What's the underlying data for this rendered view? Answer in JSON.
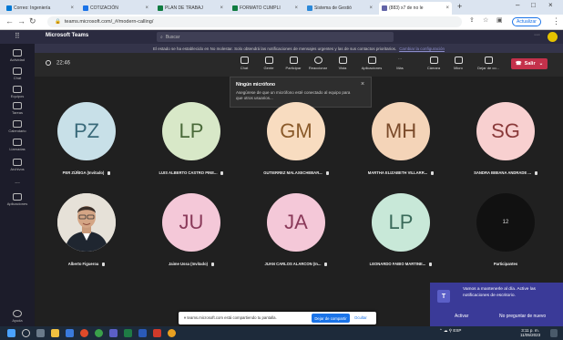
{
  "browser": {
    "tabs": [
      {
        "label": "Correo: Ingeniería",
        "color": "#0078d4"
      },
      {
        "label": "COTIZACIÓN",
        "color": "#1a73e8"
      },
      {
        "label": "PLAN DE TRABAJ",
        "color": "#107c41"
      },
      {
        "label": "FORMATO CUMPLI",
        "color": "#107c41"
      },
      {
        "label": "Sistema de Gestió",
        "color": "#2b88d8"
      },
      {
        "label": "(883) x7 de no le",
        "color": "#6264a7"
      }
    ],
    "new_tab": "+",
    "url": "teams.microsoft.com/_#/modern-calling/",
    "update_label": "Actualizar"
  },
  "teams": {
    "title": "Microsoft Teams",
    "search_placeholder": "Buscar"
  },
  "notice": {
    "text": "El estado se ha establecido en No molestar. Solo obtendrá las notificaciones de mensajes urgentes y las de sus contactos prioritarios.",
    "link": "Cambiar la configuración"
  },
  "rail": [
    {
      "label": "Actividad"
    },
    {
      "label": "Chat"
    },
    {
      "label": "Equipos"
    },
    {
      "label": "Tareas"
    },
    {
      "label": "Calendario"
    },
    {
      "label": "Llamadas"
    },
    {
      "label": "Archivos"
    },
    {
      "label": "..."
    },
    {
      "label": "Aplicaciones"
    },
    {
      "label": "Ayuda"
    }
  ],
  "meeting": {
    "timer": "22:46",
    "buttons": [
      "Chat",
      "Gente",
      "Participar",
      "Reaccionar",
      "Vista",
      "Aplicaciones",
      "Más",
      "Cámara",
      "Micro",
      "Dejar de co..."
    ],
    "leave": "Salir"
  },
  "popup": {
    "title": "Ningún micrófono",
    "desc": "Asegúrese de que un micrófono esté conectado al equipo para que otros usuarios..."
  },
  "participants_row1": [
    {
      "initials": "PZ",
      "name": "PER ZÚÑIGA (Invitado)",
      "bg": "#c8e0e8",
      "fg": "#3a6a7a"
    },
    {
      "initials": "LP",
      "name": "LUIS ALBERTO CASTRO PINE...",
      "bg": "#d8e8c8",
      "fg": "#4a6a3a"
    },
    {
      "initials": "GM",
      "name": "GUTIERREZ MALAXECHEBAR...",
      "bg": "#f8dcc0",
      "fg": "#8a5a2a"
    },
    {
      "initials": "MH",
      "name": "MARTHA ELIZABETH VILLARR...",
      "bg": "#f4d4b8",
      "fg": "#7a4a2a"
    },
    {
      "initials": "SG",
      "name": "SANDRA BIBIANA ANDRADE ...",
      "bg": "#f8d0d0",
      "fg": "#8a3a3a"
    }
  ],
  "participants_row2": [
    {
      "initials": "",
      "name": "Alberto Figueroa",
      "bg": "",
      "fg": ""
    },
    {
      "initials": "JU",
      "name": "Jaime Ussa (Invitado)",
      "bg": "#f4c8d8",
      "fg": "#8a3a5a"
    },
    {
      "initials": "JA",
      "name": "JUAN CARLOS ALARCON (In...",
      "bg": "#f4c8d8",
      "fg": "#8a3a5a"
    },
    {
      "initials": "LP",
      "name": "LEONARDO FABIO MARTINE...",
      "bg": "#c8e8d8",
      "fg": "#3a6a5a"
    },
    {
      "initials": "12",
      "name": "Participantes",
      "bg": "#111111",
      "fg": "#dddddd"
    }
  ],
  "toast": {
    "message": "Vamos a mantenerle al día. Active las notificaciones de escritorio.",
    "activate": "Activar",
    "dismiss": "No preguntar de nuevo"
  },
  "sharebar": {
    "text": "teams.microsoft.com está compartiendo tu pantalla.",
    "stop": "Dejar de compartir",
    "hide": "Ocultar"
  },
  "taskbar": {
    "tray": "ESP",
    "time": "3:11 p. m.",
    "date": "11/05/2023"
  }
}
